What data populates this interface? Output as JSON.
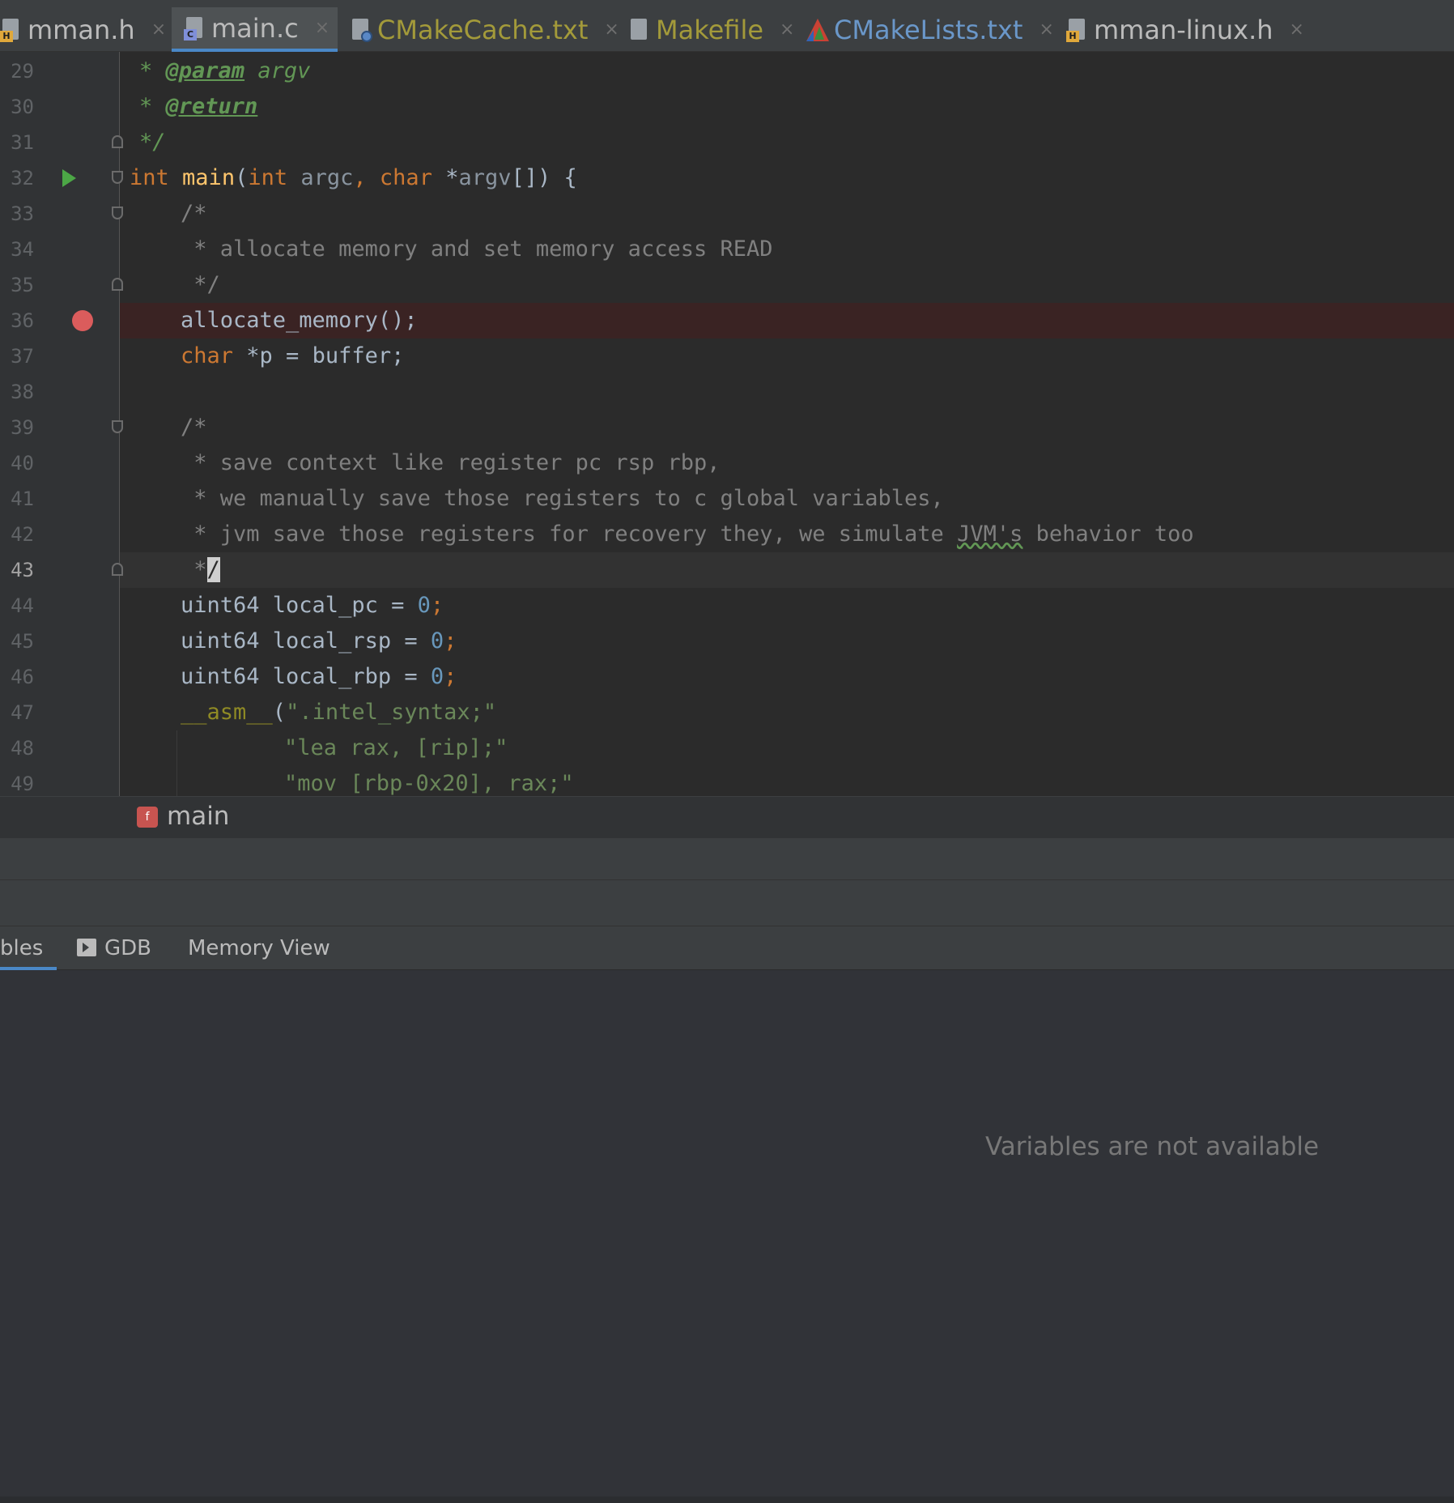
{
  "tabs": [
    {
      "label": "mman.h",
      "icon": "h-file-icon",
      "color": "#bbbbbb"
    },
    {
      "label": "main.c",
      "icon": "c-file-icon",
      "color": "#bbbbbb",
      "active": true
    },
    {
      "label": "CMakeCache.txt",
      "icon": "cmake-cache-icon",
      "color": "#a39a3a"
    },
    {
      "label": "Makefile",
      "icon": "makefile-icon",
      "color": "#a39a3a"
    },
    {
      "label": "CMakeLists.txt",
      "icon": "cmake-icon",
      "color": "#6a97c9"
    },
    {
      "label": "mman-linux.h",
      "icon": "h-file-icon",
      "color": "#bbbbbb"
    }
  ],
  "tab_close_glyph": "×",
  "editor": {
    "line_numbers": [
      "29",
      "30",
      "31",
      "32",
      "33",
      "34",
      "35",
      "36",
      "37",
      "38",
      "39",
      "40",
      "41",
      "42",
      "43",
      "44",
      "45",
      "46",
      "47",
      "48",
      "49"
    ],
    "breakpoint_line": "36",
    "current_line": "43",
    "code": {
      "l29_star": "* ",
      "l29_tag": "@param",
      "l29_rest": " argv",
      "l30_star": "* ",
      "l30_tag": "@return",
      "l31": "*/",
      "l32_kw1": "int",
      "l32_fn": "main",
      "l32_p1": "(",
      "l32_kw2": "int",
      "l32_a1": " argc",
      "l32_c": ", ",
      "l32_kw3": "char",
      "l32_p2": " *",
      "l32_a2": "argv",
      "l32_p3": "[]) {",
      "l33": "/*",
      "l34": " * allocate memory and set memory access READ",
      "l35": " */",
      "l36_fn": "allocate_memory",
      "l36_rest": "();",
      "l37_kw": "char",
      "l37_rest": " *p = buffer;",
      "l39": "/*",
      "l40": " * save context like register pc rsp rbp,",
      "l41": " * we manually save those registers to c global variables,",
      "l42_a": " * jvm save those registers for recovery they, we simulate ",
      "l42_typo": "JVM's",
      "l42_b": " behavior too",
      "l43_a": " *",
      "l43_caret": "/",
      "l44_a": "uint64 local_pc = ",
      "l44_num": "0",
      "l44_b": ";",
      "l45_a": "uint64 local_rsp = ",
      "l45_num": "0",
      "l45_b": ";",
      "l46_a": "uint64 local_rbp = ",
      "l46_num": "0",
      "l46_b": ";",
      "l47_macro": "__asm__",
      "l47_p": "(",
      "l47_str": "\".intel_syntax;\"",
      "l48_str": "\"lea rax, [rip];\"",
      "l49_str": "\"mov [rbp-0x20], rax;\""
    }
  },
  "breadcrumb": {
    "badge": "f",
    "label": "main"
  },
  "panel_tabs": {
    "variables": "bles",
    "gdb": "GDB",
    "memory": "Memory View"
  },
  "panel_message": "Variables are not available",
  "colors": {
    "accent": "#4a88c7",
    "breakpoint": "#db5c5c",
    "run": "#4ca746"
  }
}
